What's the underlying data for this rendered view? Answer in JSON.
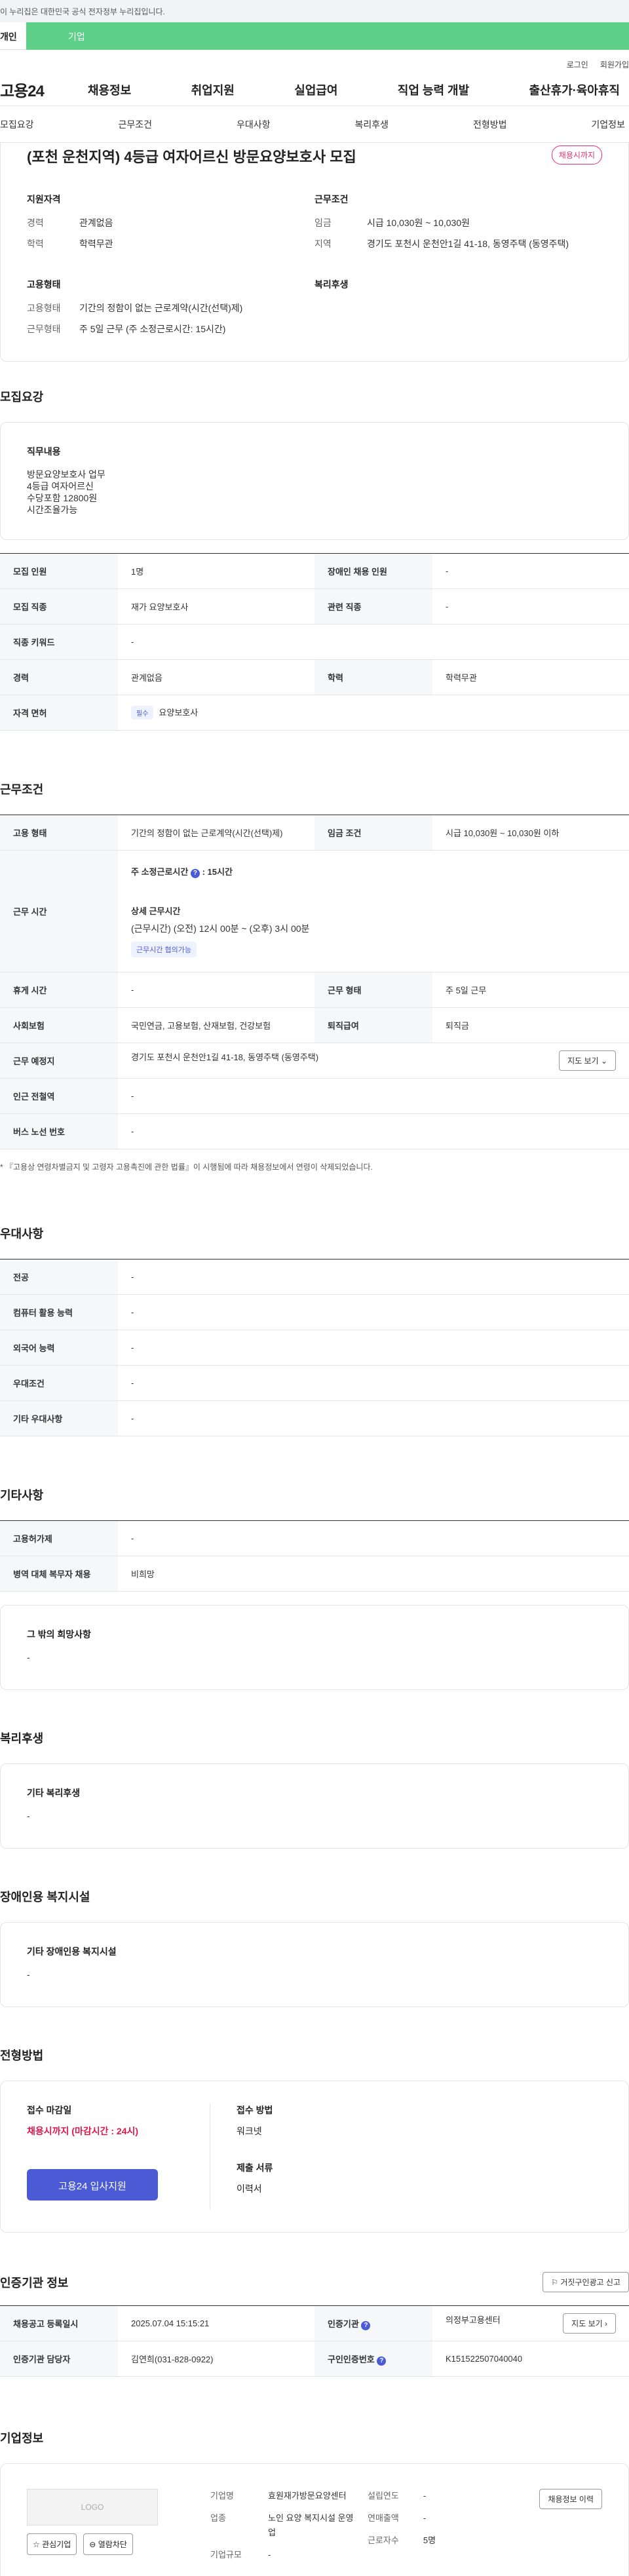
{
  "gov_banner": "이 누리집은 대한민국 공식 전자정부 누리집입니다.",
  "mode_tabs": [
    "개인",
    "기업"
  ],
  "util_links": [
    "로그인",
    "회원가입"
  ],
  "logo": "고용24",
  "gnb": [
    "채용정보",
    "취업지원",
    "실업급여",
    "직업 능력 개발",
    "출산휴가·육아휴직"
  ],
  "page_tabs": [
    "모집요강",
    "근무조건",
    "우대사항",
    "복리후생",
    "전형방법",
    "기업정보"
  ],
  "summary": {
    "title": "(포천 운천지역) 4등급 여자어르신 방문요양보호사 모집",
    "status_badge": "채용시까지",
    "qual_heading": "지원자격",
    "career_label": "경력",
    "career_value": "관계없음",
    "edu_label": "학력",
    "edu_value": "학력무관",
    "emp_heading": "고용형태",
    "emptype_label": "고용형태",
    "emptype_value": "기간의 정함이 없는 근로계약(시간(선택)제)",
    "workdays_label": "근무형태",
    "workdays_value": "주 5일 근무 (주 소정근로시간: 15시간)",
    "cond_heading": "근무조건",
    "wage_label": "임금",
    "wage_value": "시급 10,030원 ~ 10,030원",
    "region_label": "지역",
    "region_value": "경기도 포천시 운천안1길 41-18, 동영주택 (동영주택)",
    "welfare_heading": "복리후생"
  },
  "recruit": {
    "heading": "모집요강",
    "job_title": "직무내용",
    "job_text": "방문요양보호사 업무\n4등급 여자어르신\n수당포함 12800원\n시간조율가능",
    "rows": {
      "headcount_label": "모집 인원",
      "headcount_value": "1명",
      "disabled_label": "장애인 채용 인원",
      "disabled_value": "-",
      "occupation_label": "모집 직종",
      "occupation_value": "재가 요양보호사",
      "related_label": "관련 직종",
      "related_value": "-",
      "keyword_label": "직종 키워드",
      "keyword_value": "-",
      "career_label": "경력",
      "career_value": "관계없음",
      "edu_label": "학력",
      "edu_value": "학력무관",
      "license_label": "자격 면허",
      "license_chip": "필수",
      "license_value": "요양보호사"
    }
  },
  "conditions": {
    "heading": "근무조건",
    "emptype_label": "고용 형태",
    "emptype_value": "기간의 정함이 없는 근로계약(시간(선택)제)",
    "wage_label": "임금 조건",
    "wage_value": "시급 10,030원 ~ 10,030원 이하",
    "hours_label": "근무 시간",
    "hours_weekly": "주 소정근로시간",
    "hours_weekly_value": ": 15시간",
    "hours_detail_title": "상세 근무시간",
    "hours_detail": "(근무시간) (오전) 12시 00분 ~ (오후) 3시 00분",
    "hours_tag": "근무시간 협의가능",
    "rest_label": "휴게 시간",
    "rest_value": "-",
    "worktype_label": "근무 형태",
    "worktype_value": "주 5일 근무",
    "insurance_label": "사회보험",
    "insurance_value": "국민연금, 고용보험, 산재보험, 건강보험",
    "severance_label": "퇴직급여",
    "severance_value": "퇴직금",
    "location_label": "근무 예정지",
    "location_value": "경기도 포천시 운천안1길 41-18, 동영주택 (동영주택)",
    "map_button": "지도 보기",
    "subway_label": "인근 전철역",
    "subway_value": "-",
    "bus_label": "버스 노선 번호",
    "bus_value": "-",
    "note": "* 『고용상 연령차별금지 및 고령자 고용촉진에 관한 법률』이 시행됨에 따라 채용정보에서 연령이 삭제되었습니다."
  },
  "preference": {
    "heading": "우대사항",
    "rows": [
      {
        "label": "전공",
        "value": "-"
      },
      {
        "label": "컴퓨터 활용 능력",
        "value": "-"
      },
      {
        "label": "외국어 능력",
        "value": "-"
      },
      {
        "label": "우대조건",
        "value": "-"
      },
      {
        "label": "기타 우대사항",
        "value": "-"
      }
    ]
  },
  "etc": {
    "heading": "기타사항",
    "rows": [
      {
        "label": "고용허가제",
        "value": "-"
      },
      {
        "label": "병역 대체 복무자 채용",
        "value": "비희망"
      }
    ],
    "other_title": "그 밖의 희망사항",
    "other_value": "-"
  },
  "welfare": {
    "heading": "복리후생",
    "title": "기타 복리후생",
    "value": "-"
  },
  "facility": {
    "heading": "장애인용 복지시설",
    "title": "기타 장애인용 복지시설",
    "value": "-"
  },
  "process": {
    "heading": "전형방법",
    "deadline_title": "접수 마감일",
    "deadline_value": "채용시까지 (마감시간 : 24시)",
    "apply_button": "고용24 입사지원",
    "method_title": "접수 방법",
    "method_value": "워크넷",
    "docs_title": "제출 서류",
    "docs_value": "이력서"
  },
  "agency": {
    "heading": "인증기관 정보",
    "report_button": "거짓구인광고 신고",
    "reg_label": "채용공고 등록일시",
    "reg_value": "2025.07.04 15:15:21",
    "agency_label": "인증기관",
    "agency_value": "의정부고용센터",
    "map_button": "지도 보기",
    "manager_label": "인증기관 담당자",
    "manager_value": "김연희(031-828-0922)",
    "id_label": "구인인증번호",
    "id_value": "K151522507040040"
  },
  "company": {
    "heading": "기업정보",
    "logo_text": "LOGO",
    "fav_button": "관심기업",
    "block_button": "열람차단",
    "history_button": "채용정보 이력",
    "name_label": "기업명",
    "name_value": "효원재가방문요양센터",
    "industry_label": "업종",
    "industry_value": "노인 요양 복지시설 운영업",
    "size_label": "기업규모",
    "size_value": "-",
    "founded_label": "설립연도",
    "founded_value": "-",
    "revenue_label": "연매출액",
    "revenue_value": "-",
    "employees_label": "근로자수",
    "employees_value": "5명"
  },
  "colors": {
    "accent": "#4b5bd6",
    "green": "#5fd08a",
    "red": "#e0174a"
  }
}
